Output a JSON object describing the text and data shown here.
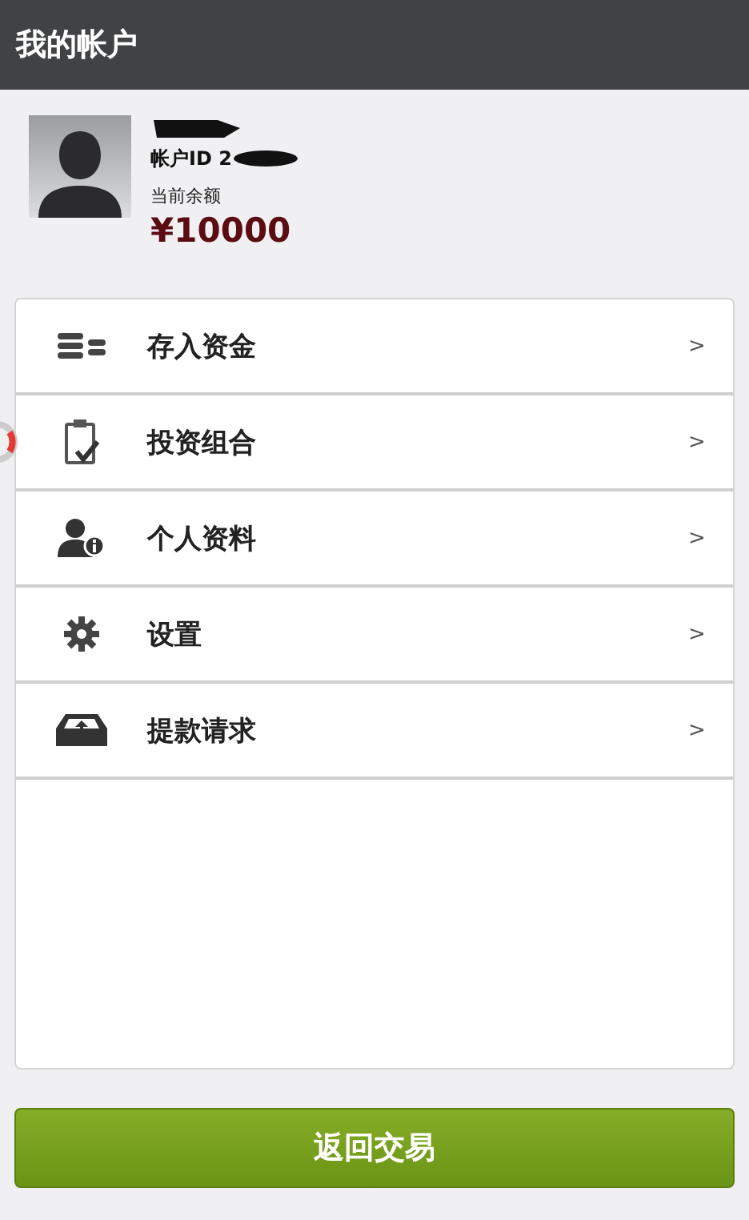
{
  "header": {
    "title": "我的帐户"
  },
  "profile": {
    "account_id": "帐户ID 2",
    "balance_label": "当前余额",
    "balance": "¥10000"
  },
  "menu": [
    {
      "kind": "coins",
      "label": "存入资金",
      "arrow": ">"
    },
    {
      "kind": "clipboard",
      "label": "投资组合",
      "arrow": ">"
    },
    {
      "kind": "user-info",
      "label": "个人资料",
      "arrow": ">"
    },
    {
      "kind": "gear",
      "label": "设置",
      "arrow": ">"
    },
    {
      "kind": "tray-upload",
      "label": "提款请求",
      "arrow": ">"
    }
  ],
  "back_button": {
    "label": "返回交易"
  }
}
